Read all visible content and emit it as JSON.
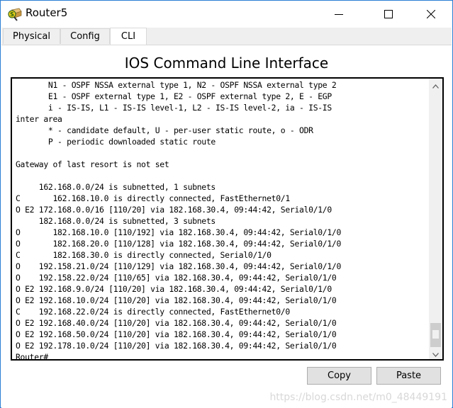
{
  "window": {
    "title": "Router5",
    "app_icon": "router-device-icon",
    "controls": {
      "minimize_icon": "minimize-icon",
      "maximize_icon": "maximize-icon",
      "close_icon": "close-icon"
    }
  },
  "tabs": [
    {
      "label": "Physical",
      "active": false
    },
    {
      "label": "Config",
      "active": false
    },
    {
      "label": "CLI",
      "active": true
    }
  ],
  "main": {
    "heading": "IOS Command Line Interface",
    "terminal_lines": [
      "       N1 - OSPF NSSA external type 1, N2 - OSPF NSSA external type 2",
      "       E1 - OSPF external type 1, E2 - OSPF external type 2, E - EGP",
      "       i - IS-IS, L1 - IS-IS level-1, L2 - IS-IS level-2, ia - IS-IS",
      "inter area",
      "       * - candidate default, U - per-user static route, o - ODR",
      "       P - periodic downloaded static route",
      "",
      "Gateway of last resort is not set",
      "",
      "     162.168.0.0/24 is subnetted, 1 subnets",
      "C       162.168.10.0 is directly connected, FastEthernet0/1",
      "O E2 172.168.0.0/16 [110/20] via 182.168.30.4, 09:44:42, Serial0/1/0",
      "     182.168.0.0/24 is subnetted, 3 subnets",
      "O       182.168.10.0 [110/192] via 182.168.30.4, 09:44:42, Serial0/1/0",
      "O       182.168.20.0 [110/128] via 182.168.30.4, 09:44:42, Serial0/1/0",
      "C       182.168.30.0 is directly connected, Serial0/1/0",
      "O    192.158.21.0/24 [110/129] via 182.168.30.4, 09:44:42, Serial0/1/0",
      "O    192.158.22.0/24 [110/65] via 182.168.30.4, 09:44:42, Serial0/1/0",
      "O E2 192.168.9.0/24 [110/20] via 182.168.30.4, 09:44:42, Serial0/1/0",
      "O E2 192.168.10.0/24 [110/20] via 182.168.30.4, 09:44:42, Serial0/1/0",
      "C    192.168.22.0/24 is directly connected, FastEthernet0/0",
      "O E2 192.168.40.0/24 [110/20] via 182.168.30.4, 09:44:42, Serial0/1/0",
      "O E2 192.168.50.0/24 [110/20] via 182.168.30.4, 09:44:42, Serial0/1/0",
      "O E2 192.178.10.0/24 [110/20] via 182.168.30.4, 09:44:42, Serial0/1/0",
      "Router#"
    ],
    "scroll_position": 0.95
  },
  "buttons": {
    "copy_label": "Copy",
    "paste_label": "Paste"
  },
  "watermark": "https://blog.csdn.net/m0_48449191"
}
